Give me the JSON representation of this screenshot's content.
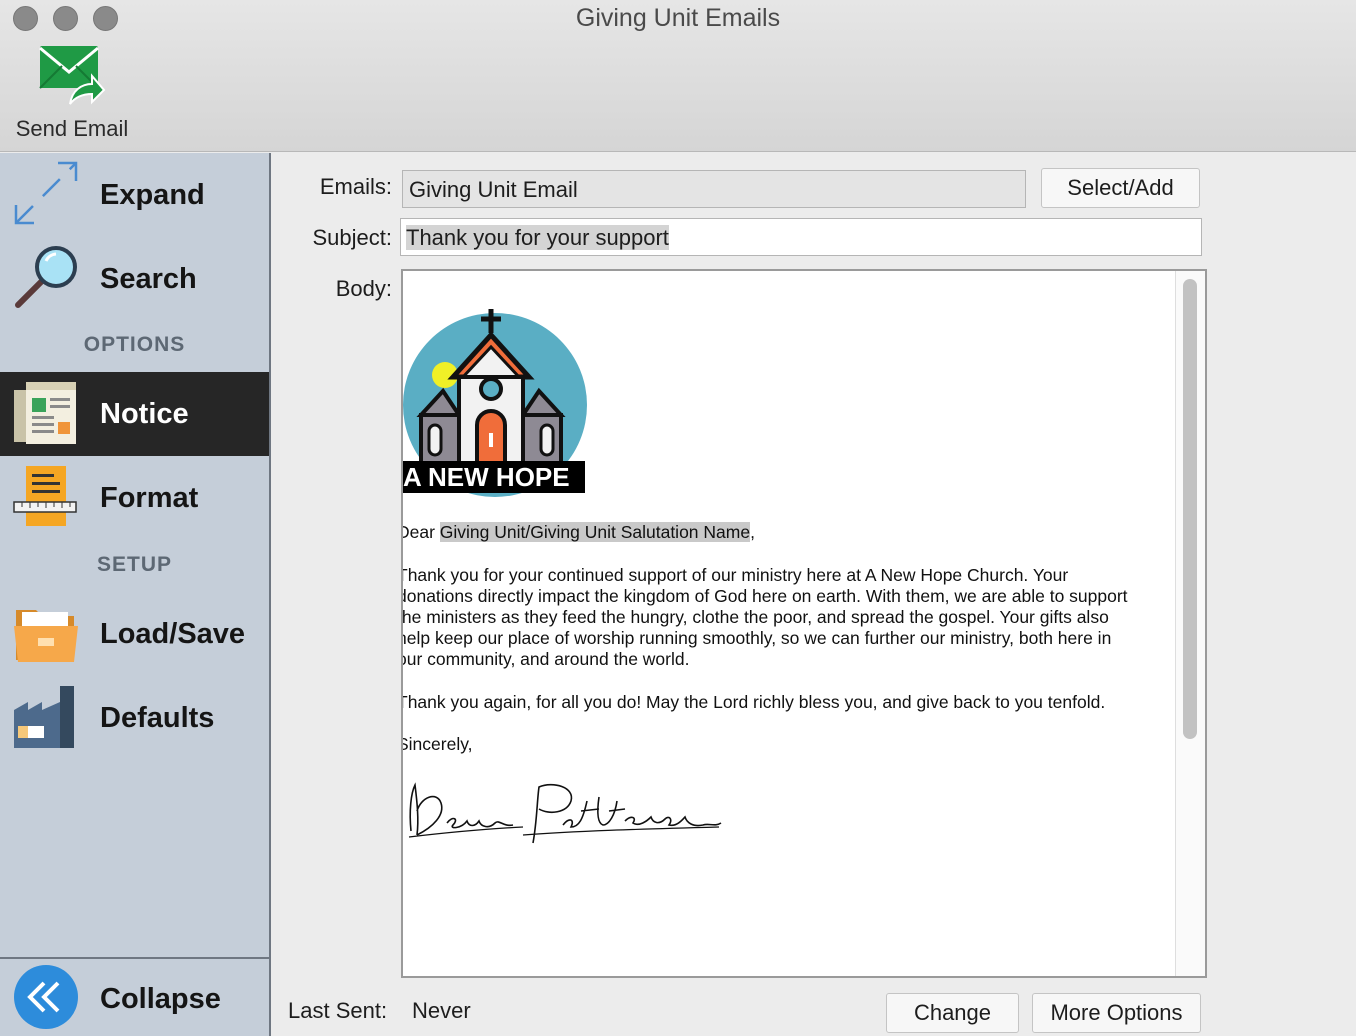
{
  "window": {
    "title": "Giving Unit Emails"
  },
  "toolbar": {
    "send_email_label": "Send Email",
    "send_email_icon": "envelope-send-icon"
  },
  "sidebar": {
    "items": [
      {
        "label": "Expand",
        "icon": "expand-arrows-icon"
      },
      {
        "label": "Search",
        "icon": "magnifier-icon"
      },
      {
        "label": "Notice",
        "icon": "newspaper-icon",
        "active": true
      },
      {
        "label": "Format",
        "icon": "ruler-pencil-icon"
      },
      {
        "label": "Load/Save",
        "icon": "folder-icon"
      },
      {
        "label": "Defaults",
        "icon": "factory-icon"
      }
    ],
    "sections": {
      "options": "OPTIONS",
      "setup": "SETUP"
    },
    "collapse_label": "Collapse"
  },
  "form": {
    "emails_label": "Emails:",
    "emails_value": "Giving Unit Email",
    "select_add_label": "Select/Add",
    "subject_label": "Subject:",
    "subject_value": "Thank you for your support",
    "body_label": "Body:",
    "last_sent_label": "Last Sent:",
    "last_sent_value": "Never",
    "change_label": "Change",
    "more_options_label": "More Options"
  },
  "body": {
    "logo_text": "A NEW HOPE",
    "greeting_prefix": "Dear ",
    "greeting_merge": "Giving Unit/Giving Unit Salutation Name",
    "greeting_suffix": ",",
    "paragraph1": [
      "Thank you for your continued support of our ministry here at A New Hope Church. Your",
      "donations directly impact the kingdom of God here on earth. With them, we are able to support",
      "the ministers as they feed the hungry, clothe the poor, and spread the gospel. Your gifts also",
      "help keep our place of worship running smoothly, so we can further our ministry, both here in",
      "our community, and around the world."
    ],
    "paragraph2": "Thank you again, for all you do! May the Lord richly bless you, and give back to you tenfold.",
    "closing": "Sincerely,",
    "signature_text": "Dean Patterson"
  },
  "colors": {
    "sidebar_bg": "#c5ced9",
    "sidebar_active_bg": "#262626",
    "collapse_blue": "#2d8cdb",
    "send_icon_green": "#1f9a45",
    "logo_circle": "#5aaec4"
  }
}
